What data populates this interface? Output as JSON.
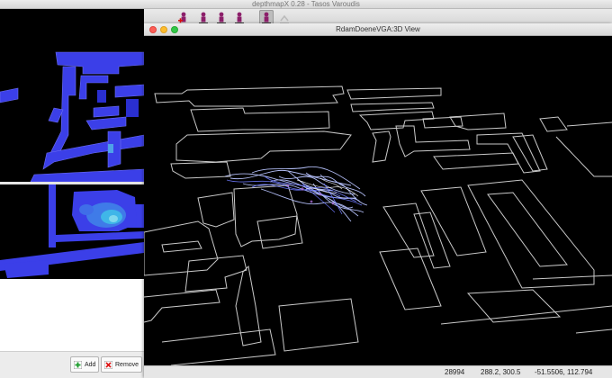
{
  "app": {
    "main_window_title": "depthmapX 0.28 - Tasos Varoudis",
    "view_window_title": "RdamDoeneVGA:3D View"
  },
  "toolbar": {
    "buttons": [
      {
        "name": "add-agent",
        "icon": "agent-plus-icon",
        "active": false
      },
      {
        "name": "add-agent-2",
        "icon": "agent-icon",
        "active": false
      },
      {
        "name": "agent-walk",
        "icon": "agent-icon",
        "active": false
      },
      {
        "name": "agent-trails",
        "icon": "agent-icon",
        "active": false
      },
      {
        "name": "agent-selected",
        "icon": "agent-icon",
        "active": true
      },
      {
        "name": "agent-move",
        "icon": "agent-arrow-icon",
        "active": false
      }
    ]
  },
  "left_panel": {
    "add_label": "Add",
    "remove_label": "Remove"
  },
  "status_bar": {
    "count": "28994",
    "screen_coords": "288.2, 300.5",
    "world_coords": "-51.5506, 112.794"
  },
  "colors": {
    "map_blue": "#3b3fe8",
    "map_hot": "#3fb6e8",
    "trail_color": "#b9c4ff",
    "wireframe": "#c9c9c9",
    "close_light": "#fc5f57",
    "minimize_light": "#fdbc2e",
    "zoom_light": "#33c748"
  }
}
